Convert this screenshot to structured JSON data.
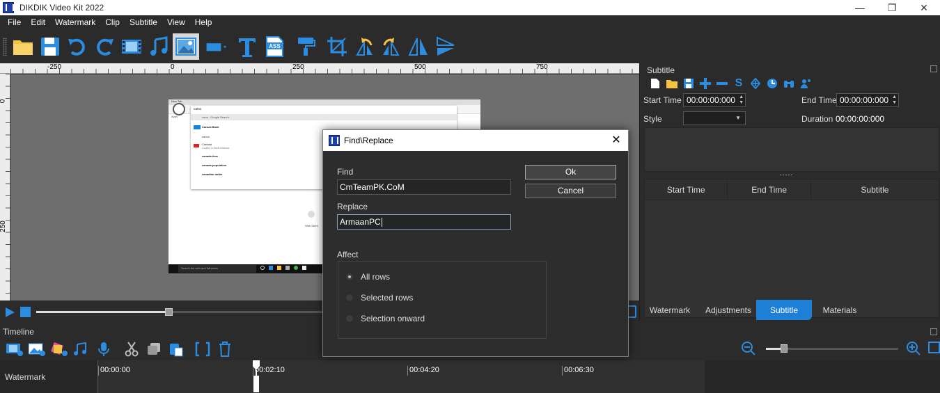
{
  "window": {
    "title": "DIKDIK Video Kit 2022"
  },
  "menu": [
    "File",
    "Edit",
    "Watermark",
    "Clip",
    "Subtitle",
    "View",
    "Help"
  ],
  "toolbar": {
    "icons": [
      "open-folder-icon",
      "save-icon",
      "undo-icon",
      "redo-icon",
      "add-video-icon",
      "add-music-icon",
      "add-image-icon",
      "add-shape-icon",
      "add-text-icon",
      "add-ass-subtitle-icon",
      "format-painter-icon",
      "crop-icon",
      "rotate-left-icon",
      "rotate-right-icon",
      "flip-horizontal-icon",
      "flip-vertical-icon"
    ],
    "ass_label": "ASS"
  },
  "ruler": {
    "h_labels": [
      "-250",
      "0",
      "250",
      "500",
      "750"
    ],
    "v_labels": [
      "0",
      "250"
    ]
  },
  "preview": {
    "search_text": "cana",
    "suggestions": [
      "cana - Google Search",
      "Canara Bank",
      "canva",
      "Canada",
      "canada time",
      "canada population",
      "canadian dollar"
    ],
    "canada_sub": "Country in North America",
    "taskbar_search": "Search the web and Windows",
    "web_store": "Web Store",
    "tab_label": "New Tab",
    "apps_label": "Apps"
  },
  "subtitle_panel": {
    "title": "Subtitle",
    "start_time_label": "Start Time",
    "start_time_value": "00:00:00:000",
    "end_time_label": "End Time",
    "end_time_value": "00:00:00:000",
    "style_label": "Style",
    "style_value": "",
    "duration_label": "Duration",
    "duration_value": "00:00:00:000",
    "columns": [
      "Start Time",
      "End Time",
      "Subtitle"
    ]
  },
  "tabs": [
    {
      "label": "Watermark",
      "active": false
    },
    {
      "label": "Adjustments",
      "active": false
    },
    {
      "label": "Subtitle",
      "active": true
    },
    {
      "label": "Materials",
      "active": false
    }
  ],
  "timeline": {
    "label": "Timeline",
    "track_label": "Watermark",
    "timecodes": [
      "00:00:00",
      "00:02:10",
      "00:04:20",
      "00:06:30"
    ]
  },
  "dialog": {
    "title": "Find\\Replace",
    "find_label": "Find",
    "find_value": "CmTeamPK.CoM",
    "replace_label": "Replace",
    "replace_value": "ArmaanPC",
    "ok_label": "Ok",
    "cancel_label": "Cancel",
    "affect_label": "Affect",
    "options": [
      {
        "label": "All rows",
        "checked": true
      },
      {
        "label": "Selected rows",
        "checked": false
      },
      {
        "label": "Selection onward",
        "checked": false
      }
    ]
  },
  "colors": {
    "accent": "#1e7fd6",
    "icon_blue": "#2c8ce0",
    "folder": "#f6c240"
  }
}
